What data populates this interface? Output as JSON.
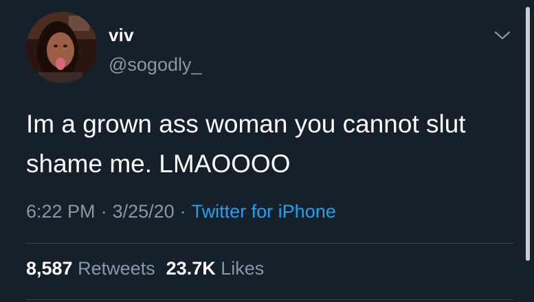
{
  "user": {
    "display_name": "viv",
    "handle": "@sogodly_",
    "avatar_icon": "profile-photo"
  },
  "tweet": {
    "text": "Im a grown ass woman you cannot slut shame me. LMAOOOO",
    "time": "6:22 PM",
    "date": "3/25/20",
    "separator": "·",
    "source": "Twitter for iPhone"
  },
  "stats": {
    "retweets_count": "8,587",
    "retweets_label": "Retweets",
    "likes_count": "23.7K",
    "likes_label": "Likes"
  },
  "icons": {
    "menu": "chevron-down-icon"
  },
  "colors": {
    "background": "#15202b",
    "text_primary": "#ffffff",
    "text_secondary": "#8899a6",
    "link": "#1da1f2",
    "divider": "#38444d"
  }
}
